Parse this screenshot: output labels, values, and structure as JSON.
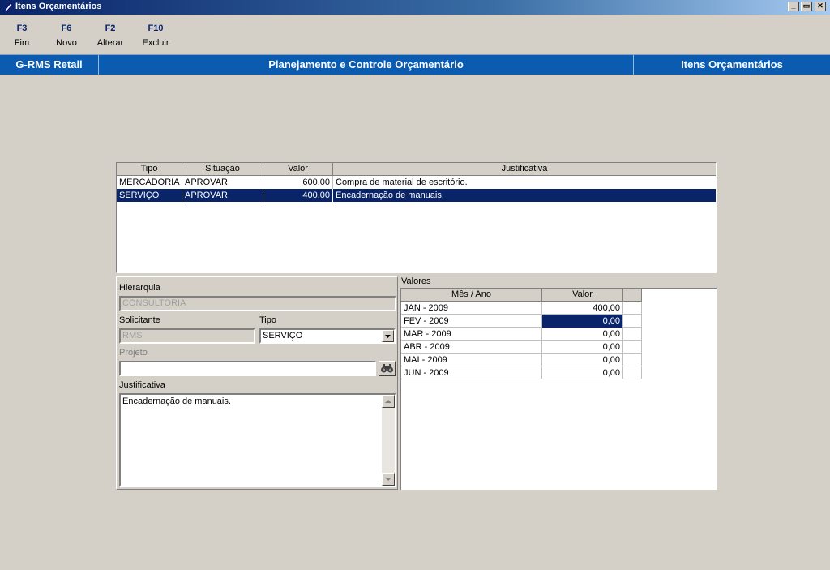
{
  "window": {
    "title": "Itens Orçamentários",
    "controls": [
      "_",
      "▭",
      "✕"
    ]
  },
  "toolbar": [
    {
      "key": "F3",
      "label": "Fim"
    },
    {
      "key": "F6",
      "label": "Novo"
    },
    {
      "key": "F2",
      "label": "Alterar"
    },
    {
      "key": "F10",
      "label": "Excluir"
    }
  ],
  "header": {
    "app": "G-RMS Retail",
    "module": "Planejamento e Controle Orçamentário",
    "screen": "Itens Orçamentários"
  },
  "items_grid": {
    "columns": [
      "Tipo",
      "Situação",
      "Valor",
      "Justificativa"
    ],
    "rows": [
      {
        "tipo": "MERCADORIA",
        "situacao": "APROVAR",
        "valor": "600,00",
        "justificativa": "Compra de material de escritório.",
        "selected": false
      },
      {
        "tipo": "SERVIÇO",
        "situacao": "APROVAR",
        "valor": "400,00",
        "justificativa": "Encadernação de manuais.",
        "selected": true
      }
    ]
  },
  "form": {
    "hierarquia_label": "Hierarquia",
    "hierarquia_value": "CONSULTORIA",
    "solicitante_label": "Solicitante",
    "solicitante_value": "RMS",
    "tipo_label": "Tipo",
    "tipo_value": "SERVIÇO",
    "projeto_label": "Projeto",
    "projeto_value": "",
    "justificativa_label": "Justificativa",
    "justificativa_value": "Encadernação de manuais."
  },
  "valores": {
    "label": "Valores",
    "columns": [
      "Mês / Ano",
      "Valor"
    ],
    "rows": [
      {
        "mes": "JAN - 2009",
        "valor": "400,00",
        "selected": false
      },
      {
        "mes": "FEV - 2009",
        "valor": "0,00",
        "selected": true
      },
      {
        "mes": "MAR - 2009",
        "valor": "0,00",
        "selected": false
      },
      {
        "mes": "ABR - 2009",
        "valor": "0,00",
        "selected": false
      },
      {
        "mes": "MAI - 2009",
        "valor": "0,00",
        "selected": false
      },
      {
        "mes": "JUN - 2009",
        "valor": "0,00",
        "selected": false
      }
    ]
  },
  "colors": {
    "header_blue": "#0b5cb0",
    "selection": "#0a246a",
    "face": "#d4d0c8"
  }
}
